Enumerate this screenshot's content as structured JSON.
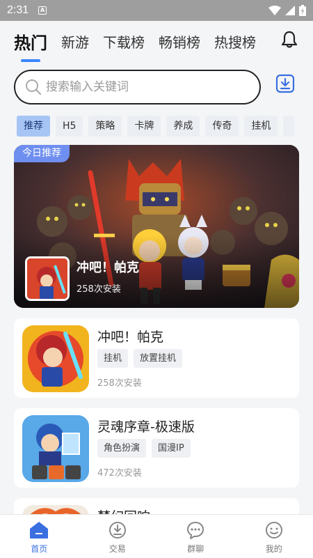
{
  "status_bar": {
    "time": "2:31",
    "indicator": "A"
  },
  "top_tabs": [
    {
      "label": "热门",
      "active": true
    },
    {
      "label": "新游",
      "active": false
    },
    {
      "label": "下载榜",
      "active": false
    },
    {
      "label": "畅销榜",
      "active": false
    },
    {
      "label": "热搜榜",
      "active": false
    }
  ],
  "search": {
    "placeholder": "搜索输入关键词",
    "value": ""
  },
  "categories": [
    "推荐",
    "H5",
    "策略",
    "卡牌",
    "养成",
    "传奇",
    "挂机",
    ""
  ],
  "banner": {
    "badge": "今日推荐",
    "title": "冲吧！帕克",
    "installs": "258次安装"
  },
  "games": [
    {
      "name": "冲吧！帕克",
      "tags": [
        "挂机",
        "放置挂机"
      ],
      "installs": "258次安装"
    },
    {
      "name": "灵魂序章-极速版",
      "tags": [
        "角色扮演",
        "国漫IP"
      ],
      "installs": "472次安装"
    },
    {
      "name": "梦幻回响",
      "tags": [],
      "installs": ""
    }
  ],
  "bottom_nav": [
    {
      "label": "首页",
      "icon": "home-icon",
      "active": true
    },
    {
      "label": "交易",
      "icon": "trade-icon",
      "active": false
    },
    {
      "label": "群聊",
      "icon": "chat-icon",
      "active": false
    },
    {
      "label": "我的",
      "icon": "profile-icon",
      "active": false
    }
  ],
  "colors": {
    "accent": "#3a86ff",
    "nav_active": "#3a6fe0",
    "badge": "#6f8ff0"
  }
}
